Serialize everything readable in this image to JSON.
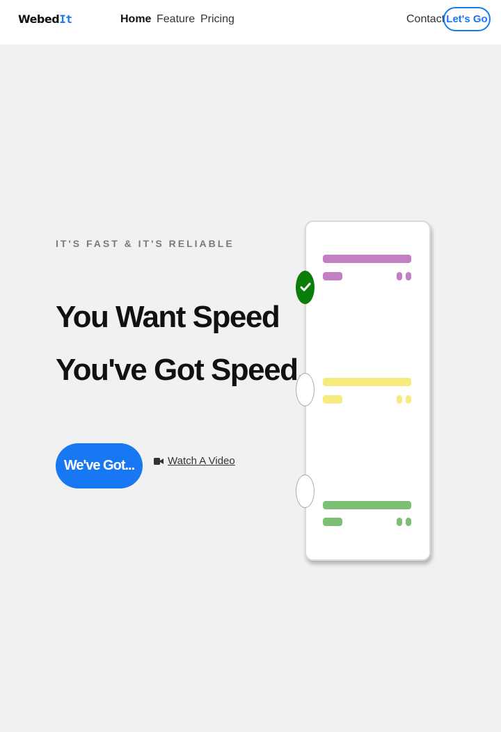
{
  "nav": {
    "logo_main": "Webed",
    "logo_accent": "It",
    "links": [
      "Home",
      "Feature",
      "Pricing"
    ],
    "contact": "Contact",
    "cta": "Let's Go"
  },
  "hero": {
    "eyebrow": "IT'S FAST & IT'S RELIABLE",
    "headline_line1": "You Want Speed",
    "headline_line2": "You've Got Speed.",
    "primary_button": "We've Got...",
    "watch_video": "Watch A Video"
  },
  "checklist": {
    "items": [
      {
        "color": "#c27fc3",
        "status": "done"
      },
      {
        "color": "#f7ea7e",
        "status": "pending"
      },
      {
        "color": "#7cbf75",
        "status": "pending"
      }
    ]
  },
  "colors": {
    "accent": "#1877f2",
    "background": "#f1f1f1",
    "check_green": "#0a7d0a"
  }
}
